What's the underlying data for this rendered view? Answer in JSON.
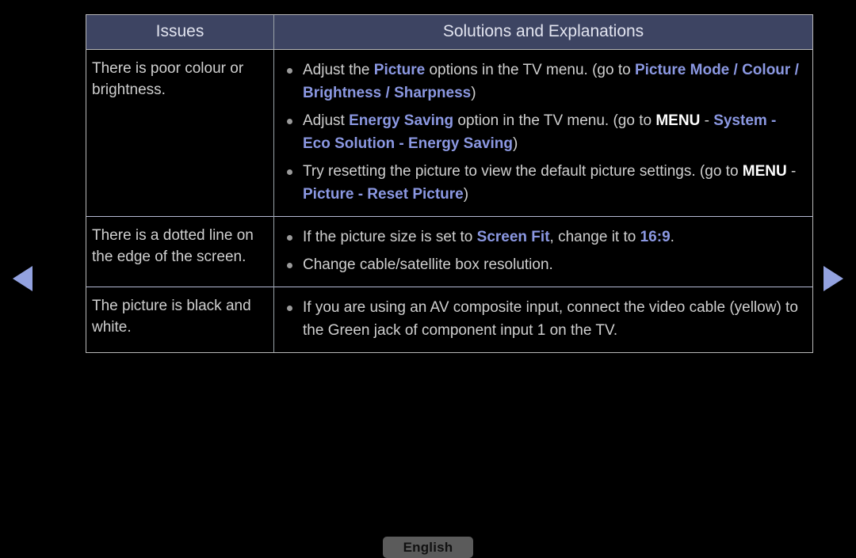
{
  "nav": {
    "prev_icon": "triangle-left-icon",
    "next_icon": "triangle-right-icon",
    "arrow_color": "#93a2e0"
  },
  "table": {
    "headers": {
      "issues": "Issues",
      "solutions": "Solutions and Explanations"
    },
    "rows": [
      {
        "issue": "There is poor colour or brightness.",
        "issue_line_1": "There is poor colour or",
        "issue_line_2": "brightness.",
        "bullets": [
          {
            "id": "picture-options",
            "segments": [
              {
                "text": "Adjust the ",
                "style": "normal"
              },
              {
                "text": "Picture",
                "style": "highlight"
              },
              {
                "text": " options in the TV menu. (go to ",
                "style": "normal"
              },
              {
                "text": "Picture Mode / Colour / Brightness / Sharpness",
                "style": "highlight"
              },
              {
                "text": ")",
                "style": "normal"
              }
            ]
          },
          {
            "id": "energy-saving",
            "segments": [
              {
                "text": "Adjust ",
                "style": "normal"
              },
              {
                "text": "Energy Saving",
                "style": "highlight"
              },
              {
                "text": " option in the TV menu. (go to ",
                "style": "normal"
              },
              {
                "text": "MENU",
                "style": "white-bold"
              },
              {
                "text": " - ",
                "style": "normal"
              },
              {
                "text": "System - Eco Solution - Energy Saving",
                "style": "highlight"
              },
              {
                "text": ")",
                "style": "normal"
              }
            ]
          },
          {
            "id": "reset-picture",
            "segments": [
              {
                "text": "Try resetting the picture to view the default picture settings. (go to ",
                "style": "normal"
              },
              {
                "text": "MENU",
                "style": "white-bold"
              },
              {
                "text": " - ",
                "style": "normal"
              },
              {
                "text": "Picture - Reset Picture",
                "style": "highlight"
              },
              {
                "text": ")",
                "style": "normal"
              }
            ]
          }
        ]
      },
      {
        "issue": "There is a dotted line on the edge of the screen.",
        "issue_line_1": "There is a dotted line on",
        "issue_line_2": "the edge of the screen.",
        "bullets": [
          {
            "id": "screen-fit",
            "segments": [
              {
                "text": "If the picture size is set to ",
                "style": "normal"
              },
              {
                "text": "Screen Fit",
                "style": "highlight"
              },
              {
                "text": ", change it to ",
                "style": "normal"
              },
              {
                "text": "16:9",
                "style": "highlight"
              },
              {
                "text": ".",
                "style": "normal"
              }
            ]
          },
          {
            "id": "box-resolution",
            "segments": [
              {
                "text": "Change cable/satellite box resolution.",
                "style": "normal"
              }
            ]
          }
        ]
      },
      {
        "issue": "The picture is black and white.",
        "issue_line_1": "The picture is black and",
        "issue_line_2": "white.",
        "bullets": [
          {
            "id": "av-composite",
            "segments": [
              {
                "text": "If you are using an AV composite input, connect the video cable (yellow) to the Green jack of component input 1 on the TV.",
                "style": "normal"
              }
            ]
          }
        ]
      }
    ]
  },
  "footer": {
    "language_label": "English"
  },
  "colors": {
    "background": "#000000",
    "header_bg": "#3d4462",
    "header_text": "#e2e4ef",
    "body_text": "#cfcfcf",
    "highlight": "#8b98e2",
    "white_bold": "#ffffff",
    "table_border": "#b9b9b9",
    "row_separator": "#b6bad4",
    "column_separator": "#9aa3a8",
    "bullet": "#9b9b9b",
    "lang_button_bg": "#5b5b5b",
    "lang_button_text": "#111111"
  }
}
